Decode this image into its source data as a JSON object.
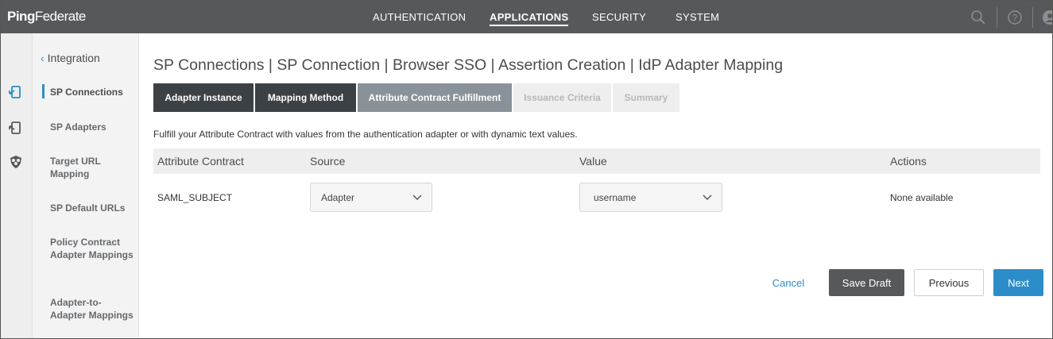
{
  "app": {
    "logo_prefix": "Ping",
    "logo_suffix": "Federate"
  },
  "topnav": {
    "items": [
      {
        "label": "AUTHENTICATION",
        "active": false
      },
      {
        "label": "APPLICATIONS",
        "active": true
      },
      {
        "label": "SECURITY",
        "active": false
      },
      {
        "label": "SYSTEM",
        "active": false
      }
    ],
    "icons": [
      "search-icon",
      "help-icon",
      "user-icon"
    ]
  },
  "rail": {
    "icons": [
      "sp-connections-icon",
      "sp-adapters-icon",
      "shield-users-icon"
    ]
  },
  "sidebar": {
    "back_label": "Integration",
    "items": [
      {
        "label": "SP Connections",
        "active": true
      },
      {
        "label": "SP Adapters",
        "active": false
      },
      {
        "label": "Target URL Mapping",
        "active": false
      },
      {
        "label": "SP Default URLs",
        "active": false
      },
      {
        "label": "Policy Contract Adapter Mappings",
        "active": false
      },
      {
        "label": "Adapter-to-Adapter Mappings",
        "active": false
      }
    ]
  },
  "breadcrumb": "SP Connections | SP Connection | Browser SSO | Assertion Creation | IdP Adapter Mapping",
  "tabs": [
    {
      "label": "Adapter Instance",
      "state": "done"
    },
    {
      "label": "Mapping Method",
      "state": "done"
    },
    {
      "label": "Attribute Contract Fulfillment",
      "state": "current"
    },
    {
      "label": "Issuance Criteria",
      "state": "future"
    },
    {
      "label": "Summary",
      "state": "future"
    }
  ],
  "description": "Fulfill your Attribute Contract with values from the authentication adapter or with dynamic text values.",
  "table": {
    "headers": [
      "Attribute Contract",
      "Source",
      "Value",
      "Actions"
    ],
    "rows": [
      {
        "attribute": "SAML_SUBJECT",
        "source": "Adapter",
        "value": "username",
        "actions": "None available"
      }
    ]
  },
  "buttons": {
    "cancel": "Cancel",
    "save_draft": "Save Draft",
    "previous": "Previous",
    "next": "Next"
  },
  "colors": {
    "topbar": "#56595c",
    "accent": "#2d8dc9",
    "tab_done": "#3c4146",
    "tab_current": "#8a9299"
  }
}
